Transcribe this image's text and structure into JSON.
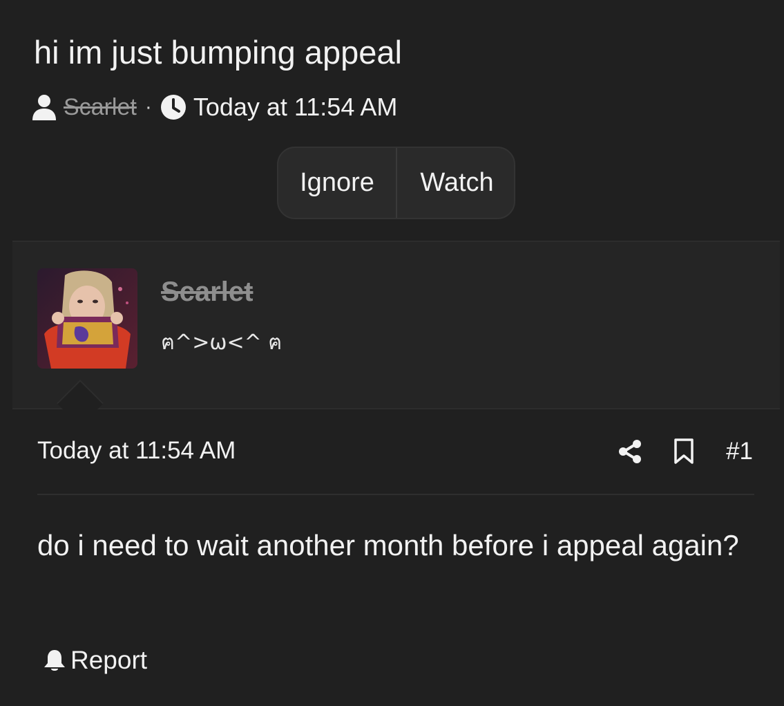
{
  "thread": {
    "title": "hi im just bumping appeal",
    "author": "Scarlet",
    "separator": "·",
    "timestamp": "Today at 11:54 AM"
  },
  "actions": {
    "ignore_label": "Ignore",
    "watch_label": "Watch"
  },
  "user_card": {
    "username": "Scarlet",
    "user_title": "ฅ^>ω<^ ฅ"
  },
  "post": {
    "timestamp": "Today at 11:54 AM",
    "number": "#1",
    "body": "do i need to wait another month before i appeal again?",
    "report_label": "Report"
  },
  "icons": {
    "author": "user-icon",
    "time": "clock-icon",
    "share": "share-icon",
    "bookmark": "bookmark-icon",
    "report": "bell-icon"
  }
}
